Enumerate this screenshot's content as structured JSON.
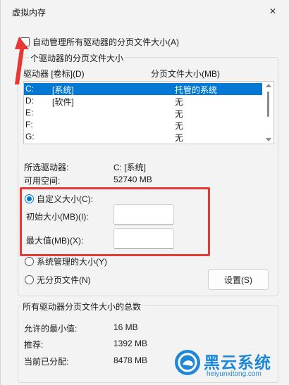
{
  "window": {
    "title": "虚拟内存",
    "close_glyph": "✕"
  },
  "auto_manage": {
    "label": "自动管理所有驱动器的分页文件大小(A)",
    "checked": false
  },
  "drives_group": {
    "title": "每个驱动器的分页文件大小",
    "title_visible": "个驱动器的分页文件大小",
    "col_drive": "驱动器 [卷标](D)",
    "col_size": "分页文件大小(MB)",
    "rows": [
      {
        "drive": "C:",
        "label": "[系统]",
        "size": "托管的系统",
        "selected": true
      },
      {
        "drive": "D:",
        "label": "[软件]",
        "size": "无",
        "selected": false
      },
      {
        "drive": "E:",
        "label": "",
        "size": "无",
        "selected": false
      },
      {
        "drive": "F:",
        "label": "",
        "size": "无",
        "selected": false
      },
      {
        "drive": "G:",
        "label": "",
        "size": "无",
        "selected": false
      }
    ],
    "selected_drive_label": "所选驱动器:",
    "selected_drive_value": "C:  [系统]",
    "free_space_label": "可用空间:",
    "free_space_value": "52740 MB",
    "custom_size_label": "自定义大小(C):",
    "custom_size_selected": true,
    "initial_size_label": "初始大小(MB)(I):",
    "initial_size_value": "",
    "max_size_label": "最大值(MB)(X):",
    "max_size_value": "",
    "system_managed_label": "系统管理的大小(Y)",
    "no_paging_label": "无分页文件(N)",
    "set_button": "设置(S)"
  },
  "totals_group": {
    "title": "所有驱动器分页文件大小的总数",
    "min_label": "允许的最小值:",
    "min_value": "16 MB",
    "recommended_label": "推荐:",
    "recommended_value": "1392 MB",
    "current_label": "当前已分配:",
    "current_value": "8478 MB"
  },
  "watermark": {
    "title": "黑云系统",
    "subtitle": "heiyunxitong.com"
  },
  "colors": {
    "accent": "#0078d4",
    "annotation": "#e53935",
    "watermark": "#1e88d6"
  }
}
